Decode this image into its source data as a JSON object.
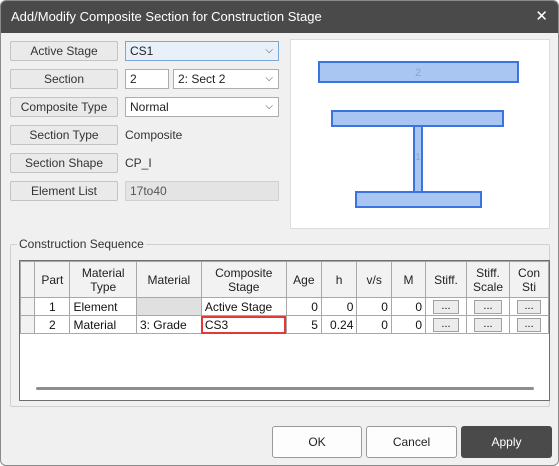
{
  "window": {
    "title": "Add/Modify Composite Section for Construction Stage",
    "close_glyph": "✕"
  },
  "form": {
    "active_stage": {
      "label": "Active Stage",
      "value": "CS1"
    },
    "section": {
      "label": "Section",
      "number": "2",
      "value": "2: Sect 2"
    },
    "composite_type": {
      "label": "Composite Type",
      "value": "Normal"
    },
    "section_type": {
      "label": "Section Type",
      "value": "Composite"
    },
    "section_shape": {
      "label": "Section Shape",
      "value": "CP_I"
    },
    "element_list": {
      "label": "Element List",
      "value": "17to40"
    }
  },
  "preview": {
    "slab_label": "2",
    "web_label": "1",
    "fill_color": "#a9c5f2",
    "stroke_color": "#3b74e0",
    "label_color": "#8aa2c9"
  },
  "sequence": {
    "title": "Construction Sequence",
    "columns": [
      "Part",
      "Material\nType",
      "Material",
      "Composite\nStage",
      "Age",
      "h",
      "v/s",
      "M",
      "Stiff.",
      "Stiff.\nScale",
      "Con\nSti"
    ],
    "rows": [
      {
        "part": "1",
        "material_type": "Element",
        "material": "",
        "composite_stage": "Active Stage",
        "age": "0",
        "h": "0",
        "vs": "0",
        "m": "0",
        "stiff": "...",
        "stiff_scale": "...",
        "con": "..."
      },
      {
        "part": "2",
        "material_type": "Material",
        "material": "3: Grade",
        "composite_stage": "CS3",
        "age": "5",
        "h": "0.24",
        "vs": "0",
        "m": "0",
        "stiff": "...",
        "stiff_scale": "...",
        "con": "..."
      }
    ]
  },
  "buttons": {
    "ok": "OK",
    "cancel": "Cancel",
    "apply": "Apply"
  },
  "colors": {
    "highlight": "#e53935",
    "primary_button": "#4a4a4a",
    "titlebar": "#4a4a4a"
  }
}
